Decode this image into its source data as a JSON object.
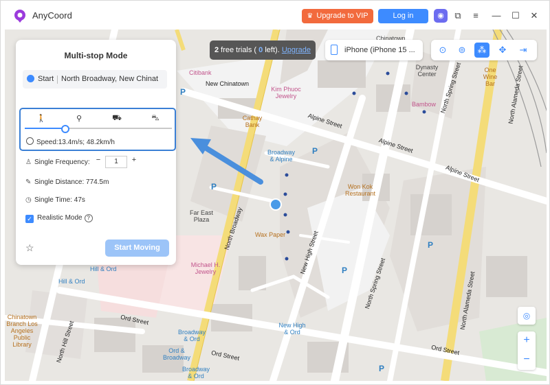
{
  "app": {
    "title": "AnyCoord",
    "vip_label": "Upgrade to VIP",
    "login_label": "Log in"
  },
  "trials": {
    "count": "2",
    "prefix": "free trials (",
    "left_num": "0",
    "suffix": "left).",
    "upgrade": "Upgrade"
  },
  "device": {
    "label": "iPhone (iPhone 15 ..."
  },
  "panel": {
    "title": "Multi-stop Mode",
    "start_label": "Start",
    "start_value": "North Broadway,  New Chinat",
    "speed": "Speed:13.4m/s; 48.2km/h",
    "speed_fraction": 0.27,
    "frequency_label": "Single Frequency:",
    "frequency_value": "1",
    "distance": "Single Distance: 774.5m",
    "time": "Single Time: 47s",
    "realistic": "Realistic Mode",
    "start_button": "Start Moving"
  },
  "colors": {
    "accent": "#3d8bff",
    "vip": "#f26a3d",
    "highlight": "#3a7fd5"
  },
  "map": {
    "streets": [
      "New Chinatown",
      "Alpine Street",
      "Alpine Street",
      "Alpine Street",
      "North Broadway",
      "New High Street",
      "North Spring Street",
      "North Spring Street",
      "North Alameda Street",
      "North Alameda Street",
      "Ord Street",
      "Ord Street",
      "North Hill Street",
      "Ord Street"
    ],
    "places": [
      "Citibank",
      "Kim Phuoc Jewelry",
      "Cathay Bank",
      "Broadway & Alpine",
      "Won Kok Restaurant",
      "Far East Plaza",
      "Wax Paper",
      "Michael H. Jewelry",
      "Hill & Ord",
      "Hill & Ord",
      "Chinatown Branch Los Angeles Public Library",
      "Broadway & Ord",
      "Ord & Broadway",
      "Broadway & Ord",
      "New High & Ord",
      "Dynasty Center",
      "Bambow",
      "One Wine Bar",
      "Chinatown"
    ]
  }
}
